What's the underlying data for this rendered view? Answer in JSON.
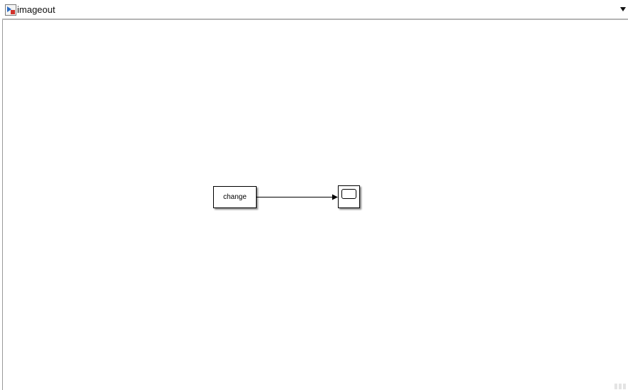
{
  "breadcrumb": {
    "model_name": "imageout",
    "model_icon": "simulink-model-icon",
    "dropdown_icon": "chevron-down-icon"
  },
  "canvas": {
    "blocks": [
      {
        "id": "change",
        "label": "change",
        "type": "subsystem"
      },
      {
        "id": "scope",
        "label": "",
        "type": "scope",
        "icon": "scope-icon"
      }
    ],
    "signals": [
      {
        "from": "change",
        "to": "scope"
      }
    ]
  },
  "colors": {
    "background": "#ffffff",
    "block_border": "#000000",
    "divider": "#b4b4b4"
  }
}
